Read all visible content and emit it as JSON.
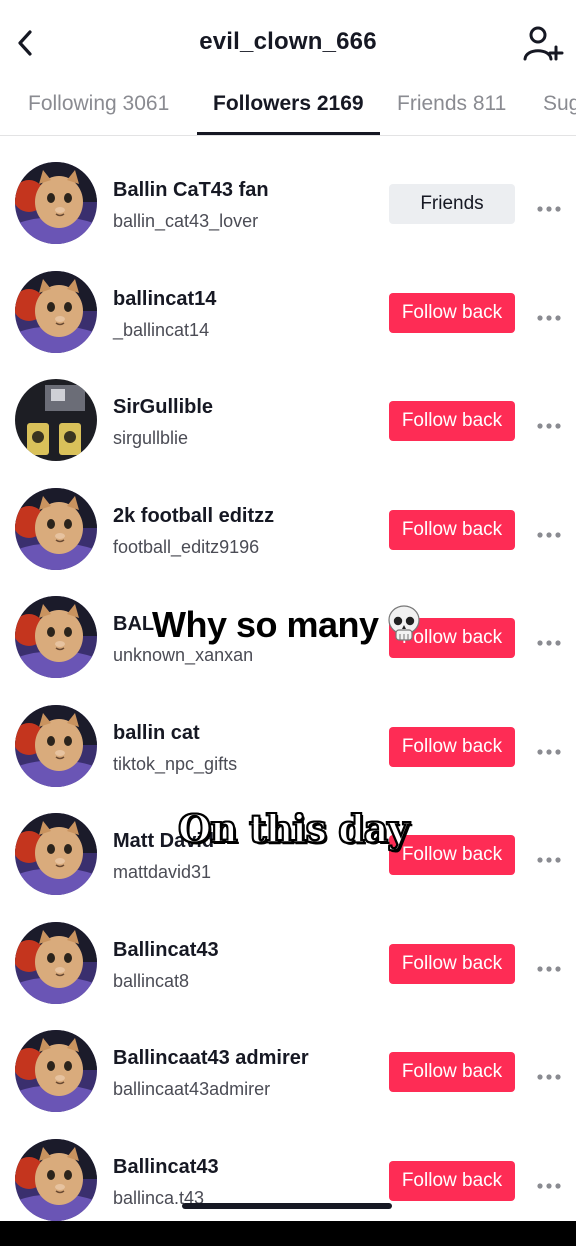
{
  "header": {
    "title": "evil_clown_666",
    "back_icon": "chevron-left-icon",
    "add_user_icon": "add-user-icon"
  },
  "tabs": [
    {
      "label": "Following 3061",
      "active": false
    },
    {
      "label": "Followers 2169",
      "active": true
    },
    {
      "label": "Friends 811",
      "active": false
    },
    {
      "label": "Sug",
      "active": false
    }
  ],
  "followers": [
    {
      "name": "Ballin CaT43 fan",
      "handle": "ballin_cat43_lover",
      "button": "Friends",
      "button_type": "friends",
      "avatar": "cat"
    },
    {
      "name": "ballincat14",
      "handle": "_ballincat14",
      "button": "Follow back",
      "button_type": "follow",
      "avatar": "cat"
    },
    {
      "name": "SirGullible",
      "handle": "sirgullblie",
      "button": "Follow back",
      "button_type": "follow",
      "avatar": "dark"
    },
    {
      "name": "2k football editzz",
      "handle": "football_editz9196",
      "button": "Follow back",
      "button_type": "follow",
      "avatar": "cat"
    },
    {
      "name": "BAL",
      "handle": "unknown_xanxan",
      "button": "Follow back",
      "button_type": "follow",
      "avatar": "cat"
    },
    {
      "name": "ballin cat",
      "handle": "tiktok_npc_gifts",
      "button": "Follow back",
      "button_type": "follow",
      "avatar": "cat"
    },
    {
      "name": "Matt David",
      "handle": "mattdavid31",
      "button": "Follow back",
      "button_type": "follow",
      "avatar": "cat"
    },
    {
      "name": "Ballincat43",
      "handle": "ballincat8",
      "button": "Follow back",
      "button_type": "follow",
      "avatar": "cat"
    },
    {
      "name": "Ballincaat43 admirer",
      "handle": "ballincaat43admirer",
      "button": "Follow back",
      "button_type": "follow",
      "avatar": "cat"
    },
    {
      "name": "Ballincat43",
      "handle": "ballinca.t43",
      "button": "Follow back",
      "button_type": "follow",
      "avatar": "cat"
    }
  ],
  "captions": {
    "why": "Why so many",
    "skull_icon": "skull-emoji-icon",
    "on_this_day": "On this day"
  },
  "colors": {
    "accent": "#fe2c55",
    "text": "#161823",
    "muted": "#8a8b91",
    "friends_bg": "#eceef1"
  }
}
